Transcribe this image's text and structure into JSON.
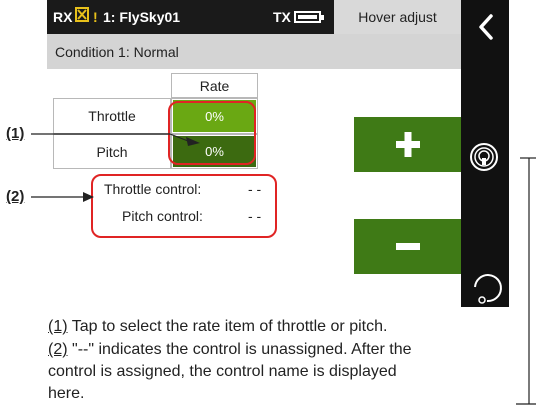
{
  "statusbar": {
    "rx_label": "RX",
    "alert_mark": "!",
    "model_label": "1: FlySky01",
    "tx_label": "TX",
    "page_title": "Hover adjust"
  },
  "condition": {
    "label": "Condition 1:  Normal"
  },
  "table": {
    "header": "Rate",
    "rows": [
      {
        "label": "Throttle",
        "value": "0%"
      },
      {
        "label": "Pitch",
        "value": "0%"
      }
    ]
  },
  "controls": {
    "throttle_label": "Throttle control:",
    "throttle_value": "- -",
    "pitch_label": "Pitch control:",
    "pitch_value": "- -"
  },
  "callouts": {
    "one": "(1)",
    "two": "(2)"
  },
  "notes": {
    "one_tag": "(1)",
    "one_text": " Tap to select the rate item of throttle or pitch.",
    "two_tag": "(2)",
    "two_text_line1": " \"--\" indicates the control is unassigned. After the",
    "two_text_line2": "control is assigned, the control name is displayed",
    "two_text_line3": "here."
  },
  "colors": {
    "throttle_cell": "#6aa813",
    "pitch_cell": "#3c6a10",
    "button_green": "#3f7a16",
    "highlight_red": "#e02424",
    "statusbar_bg": "#1a1a1a"
  },
  "icons": [
    "x-box-icon",
    "battery-icon",
    "back-icon",
    "sensor-icon",
    "undo-icon",
    "plus-icon",
    "minus-icon"
  ]
}
